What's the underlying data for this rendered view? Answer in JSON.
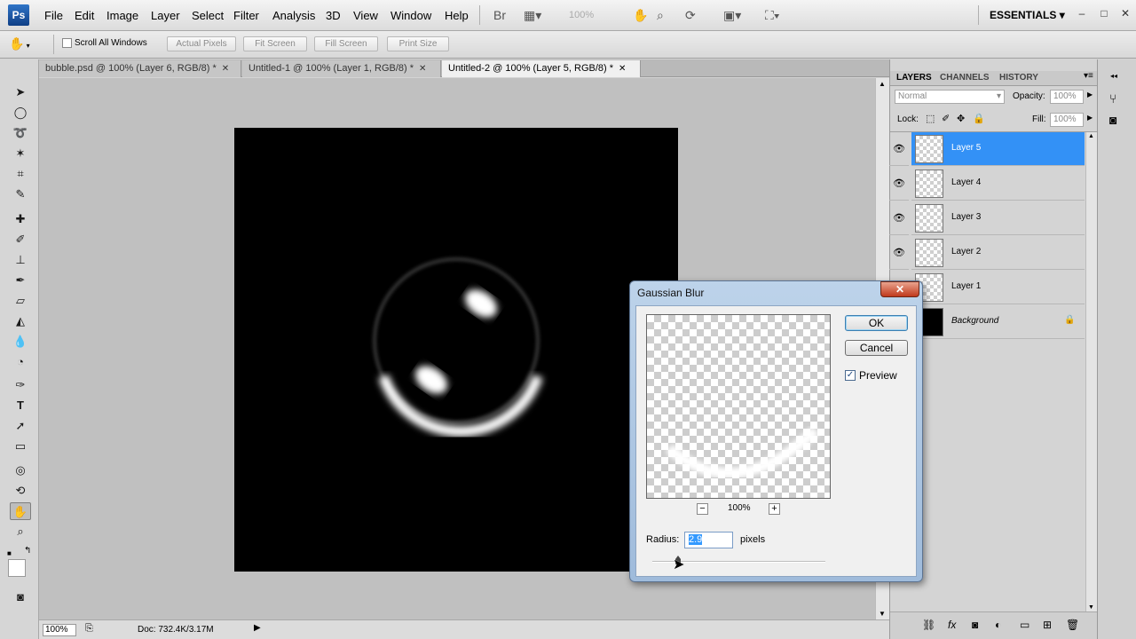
{
  "app": {
    "logo": "Ps",
    "workspace_label": "ESSENTIALS",
    "zoom_display": "100%"
  },
  "menubar": {
    "items": [
      "File",
      "Edit",
      "Image",
      "Layer",
      "Select",
      "Filter",
      "Analysis",
      "3D",
      "View",
      "Window",
      "Help"
    ],
    "window_buttons": [
      "–",
      "□",
      "✕"
    ]
  },
  "options_bar": {
    "scroll_all_label": "Scroll All Windows",
    "buttons": [
      "Actual Pixels",
      "Fit Screen",
      "Fill Screen",
      "Print Size"
    ]
  },
  "tabs": [
    {
      "label": "bubble.psd @ 100% (Layer 6, RGB/8) *",
      "active": false
    },
    {
      "label": "Untitled-1 @ 100% (Layer 1, RGB/8) *",
      "active": false
    },
    {
      "label": "Untitled-2 @ 100% (Layer 5, RGB/8) *",
      "active": true
    }
  ],
  "tools": [
    "move-tool",
    "marquee-tool",
    "lasso-tool",
    "magic-wand-tool",
    "crop-tool",
    "eyedropper-tool",
    "healing-tool",
    "brush-tool",
    "clone-stamp-tool",
    "history-brush-tool",
    "eraser-tool",
    "paint-bucket-tool",
    "blur-tool",
    "dodge-tool",
    "pen-tool",
    "type-tool",
    "path-select-tool",
    "shape-tool",
    "3d-rotate-tool",
    "3d-orbit-tool",
    "hand-tool",
    "zoom-tool"
  ],
  "status": {
    "zoom": "100%",
    "doc": "Doc: 732.4K/3.17M"
  },
  "panels": {
    "tabs": [
      "LAYERS",
      "CHANNELS",
      "HISTORY"
    ],
    "blend_mode": "Normal",
    "opacity_label": "Opacity:",
    "opacity_value": "100%",
    "lock_label": "Lock:",
    "fill_label": "Fill:",
    "fill_value": "100%",
    "layers": [
      {
        "name": "Layer 5",
        "selected": true,
        "visible": true
      },
      {
        "name": "Layer 4",
        "selected": false,
        "visible": true
      },
      {
        "name": "Layer 3",
        "selected": false,
        "visible": true
      },
      {
        "name": "Layer 2",
        "selected": false,
        "visible": true
      },
      {
        "name": "Layer 1",
        "selected": false,
        "visible": true
      },
      {
        "name": "Background",
        "selected": false,
        "visible": false,
        "locked": true
      }
    ]
  },
  "dialog": {
    "title": "Gaussian Blur",
    "ok": "OK",
    "cancel": "Cancel",
    "preview_label": "Preview",
    "preview_checked": true,
    "preview_zoom": "100%",
    "radius_label": "Radius:",
    "radius_value": "2.9",
    "radius_unit": "pixels"
  }
}
